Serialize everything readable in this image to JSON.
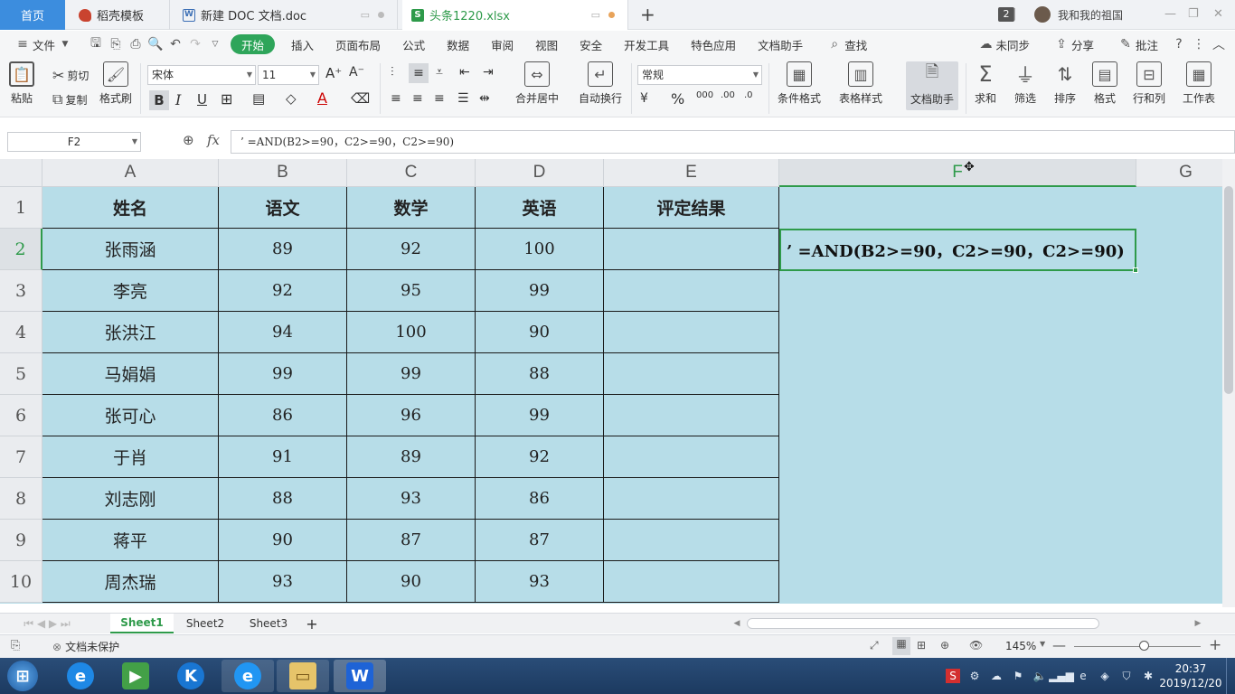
{
  "tabs": {
    "home": "首页",
    "t1": "稻壳模板",
    "t2": "新建 DOC 文档.doc",
    "t3": "头条1220.xlsx",
    "badge": "2",
    "user": "我和我的祖国"
  },
  "menu": {
    "file": "文件",
    "items": [
      "开始",
      "插入",
      "页面布局",
      "公式",
      "数据",
      "审阅",
      "视图",
      "安全",
      "开发工具",
      "特色应用",
      "文档助手"
    ],
    "search": "查找",
    "sync": "未同步",
    "share": "分享",
    "comment": "批注"
  },
  "ribbon": {
    "paste": "粘贴",
    "cut": "剪切",
    "copy": "复制",
    "format_painter": "格式刷",
    "font_name": "宋体",
    "font_size": "11",
    "merge": "合并居中",
    "wrap": "自动换行",
    "number_format": "常规",
    "cond_format": "条件格式",
    "table_style": "表格样式",
    "doc_assistant": "文档助手",
    "sum": "求和",
    "filter": "筛选",
    "sort": "排序",
    "format": "格式",
    "rowcol": "行和列",
    "worksheet": "工作表"
  },
  "formula_bar": {
    "name_box": "F2",
    "formula": "’ =AND(B2>=90，C2>=90，C2>=90)"
  },
  "sheet": {
    "columns": [
      "A",
      "B",
      "C",
      "D",
      "E",
      "F",
      "G"
    ],
    "header_row": [
      "姓名",
      "语文",
      "数学",
      "英语",
      "评定结果"
    ],
    "rows": [
      [
        "张雨涵",
        "89",
        "92",
        "100",
        ""
      ],
      [
        "李亮",
        "92",
        "95",
        "99",
        ""
      ],
      [
        "张洪江",
        "94",
        "100",
        "90",
        ""
      ],
      [
        "马娟娟",
        "99",
        "99",
        "88",
        ""
      ],
      [
        "张可心",
        "86",
        "96",
        "99",
        ""
      ],
      [
        "于肖",
        "91",
        "89",
        "92",
        ""
      ],
      [
        "刘志刚",
        "88",
        "93",
        "86",
        ""
      ],
      [
        "蒋平",
        "90",
        "87",
        "87",
        ""
      ],
      [
        "周杰瑞",
        "93",
        "90",
        "93",
        ""
      ]
    ],
    "row_numbers": [
      "1",
      "2",
      "3",
      "4",
      "5",
      "6",
      "7",
      "8",
      "9",
      "10"
    ],
    "f2_text": "’ =AND(B2>=90，C2>=90，C2>=90)"
  },
  "sheet_tabs": [
    "Sheet1",
    "Sheet2",
    "Sheet3"
  ],
  "status": {
    "protect": "文档未保护",
    "zoom": "145%"
  },
  "taskbar": {
    "time": "20:37",
    "date": "2019/12/20"
  },
  "colors": {
    "accent_green": "#2e9a4a",
    "sheet_fill": "#b7dde8",
    "home_tab": "#3c8dde"
  }
}
